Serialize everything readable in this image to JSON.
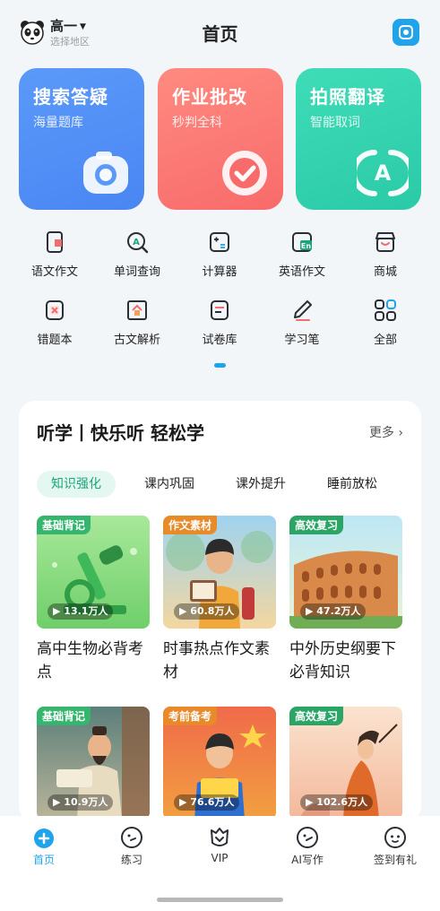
{
  "header": {
    "grade": "高一",
    "region": "选择地区",
    "title": "首页"
  },
  "feature_cards": [
    {
      "title": "搜索答疑",
      "subtitle": "海量题库",
      "icon": "camera-icon"
    },
    {
      "title": "作业批改",
      "subtitle": "秒判全科",
      "icon": "check-icon"
    },
    {
      "title": "拍照翻译",
      "subtitle": "智能取词",
      "icon": "translate-icon"
    }
  ],
  "tools": [
    {
      "label": "语文作文",
      "icon": "book-icon"
    },
    {
      "label": "单词查询",
      "icon": "word-search-icon"
    },
    {
      "label": "计算器",
      "icon": "calculator-icon"
    },
    {
      "label": "英语作文",
      "icon": "english-composition-icon"
    },
    {
      "label": "商城",
      "icon": "shop-icon"
    },
    {
      "label": "错题本",
      "icon": "mistake-book-icon"
    },
    {
      "label": "古文解析",
      "icon": "classical-chinese-icon"
    },
    {
      "label": "试卷库",
      "icon": "exam-paper-icon"
    },
    {
      "label": "学习笔",
      "icon": "study-pen-icon"
    },
    {
      "label": "全部",
      "icon": "all-apps-icon"
    }
  ],
  "listen": {
    "title": "听学丨快乐听 轻松学",
    "more": "更多",
    "tabs": [
      "知识强化",
      "课内巩固",
      "课外提升",
      "睡前放松"
    ],
    "courses": [
      {
        "tag": "基础背记",
        "plays": "13.1万人",
        "title": "高中生物必背考点"
      },
      {
        "tag": "作文素材",
        "plays": "60.8万人",
        "title": "时事热点作文素材"
      },
      {
        "tag": "高效复习",
        "plays": "47.2万人",
        "title": "中外历史纲要下必背知识"
      },
      {
        "tag": "基础背记",
        "plays": "10.9万人",
        "title": ""
      },
      {
        "tag": "考前备考",
        "plays": "76.6万人",
        "title": ""
      },
      {
        "tag": "高效复习",
        "plays": "102.6万人",
        "title": ""
      }
    ]
  },
  "bottom_nav": [
    {
      "label": "首页",
      "icon": "home-icon",
      "active": true
    },
    {
      "label": "练习",
      "icon": "practice-icon",
      "active": false
    },
    {
      "label": "VIP",
      "icon": "vip-icon",
      "active": false
    },
    {
      "label": "AI写作",
      "icon": "ai-writing-icon",
      "active": false
    },
    {
      "label": "签到有礼",
      "icon": "checkin-gift-icon",
      "active": false
    }
  ],
  "colors": {
    "accent": "#1fa4ec",
    "card_blue": "#5b99f9",
    "card_red": "#f86b6b",
    "card_green": "#2bcaa6",
    "tab_active": "#1aa57a"
  }
}
